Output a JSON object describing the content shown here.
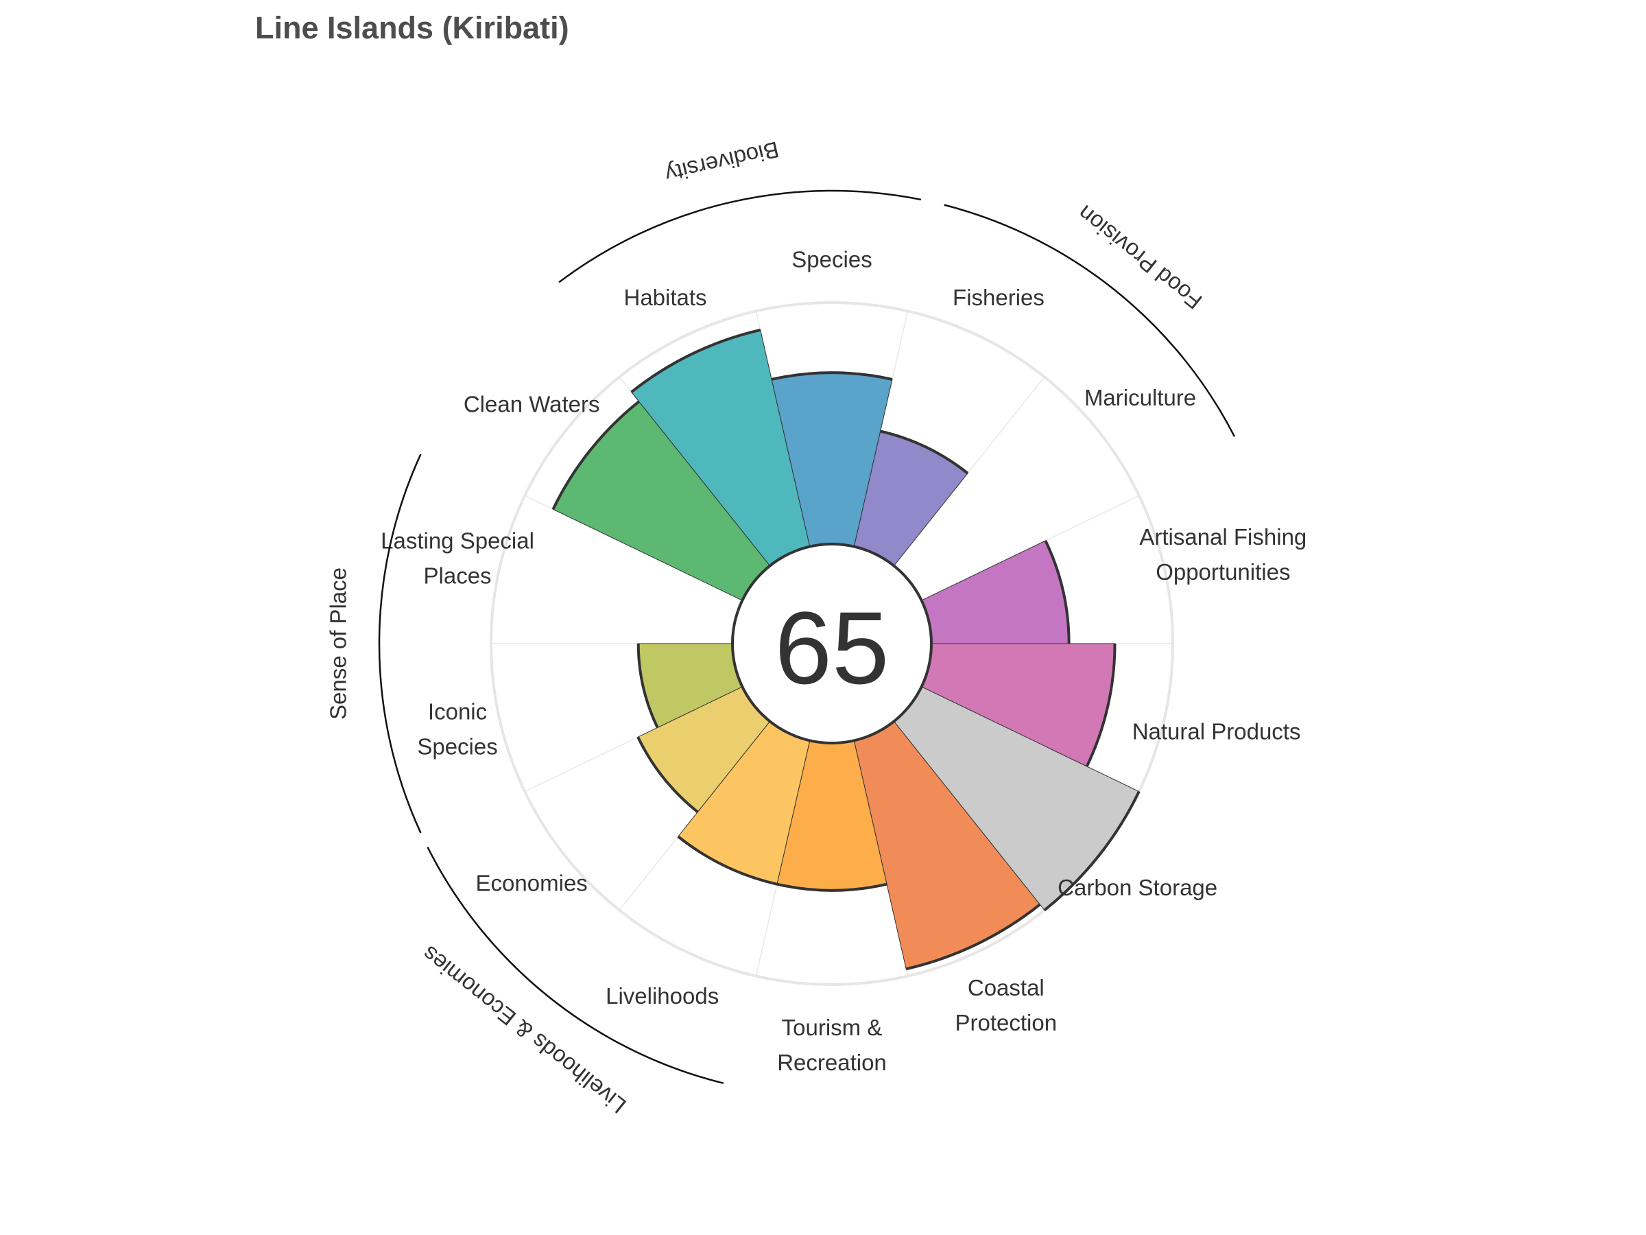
{
  "chart_data": {
    "type": "polar-bar",
    "title": "Line Islands (Kiribati)",
    "score": "65",
    "rlim": [
      0,
      100
    ],
    "goals": [
      {
        "label": [
          "Fisheries"
        ],
        "value": 49,
        "color": "#9189ca"
      },
      {
        "label": [
          "Mariculture"
        ],
        "value": 0,
        "color": "#9189ca"
      },
      {
        "label": [
          "Artisanal Fishing",
          "Opportunities"
        ],
        "value": 57,
        "color": "#c476c3"
      },
      {
        "label": [
          "Natural Products"
        ],
        "value": 76,
        "color": "#d278b5"
      },
      {
        "label": [
          "Carbon Storage"
        ],
        "value": 100,
        "color": "#cbcbcb"
      },
      {
        "label": [
          "Coastal",
          "Protection"
        ],
        "value": 97,
        "color": "#f18c58"
      },
      {
        "label": [
          "Tourism &",
          "Recreation"
        ],
        "value": 61,
        "color": "#fdae4b"
      },
      {
        "label": [
          "Livelihoods"
        ],
        "value": 61,
        "color": "#fdc562"
      },
      {
        "label": [
          "Economies"
        ],
        "value": 48,
        "color": "#ebcf6e"
      },
      {
        "label": [
          "Iconic",
          "Species"
        ],
        "value": 39,
        "color": "#bfc862"
      },
      {
        "label": [
          "Lasting Special",
          "Places"
        ],
        "value": 0,
        "color": "#a8c55d"
      },
      {
        "label": [
          "Clean Waters"
        ],
        "value": 87,
        "color": "#5db872"
      },
      {
        "label": [
          "Habitats"
        ],
        "value": 92,
        "color": "#4fb8bd"
      },
      {
        "label": [
          "Species"
        ],
        "value": 71,
        "color": "#5aa3ca"
      }
    ],
    "groups": [
      {
        "label": "Food Provision"
      },
      {
        "label": "Biodiversity"
      },
      {
        "label": "Sense of Place"
      },
      {
        "label": "Livelihoods & Economies"
      }
    ]
  }
}
